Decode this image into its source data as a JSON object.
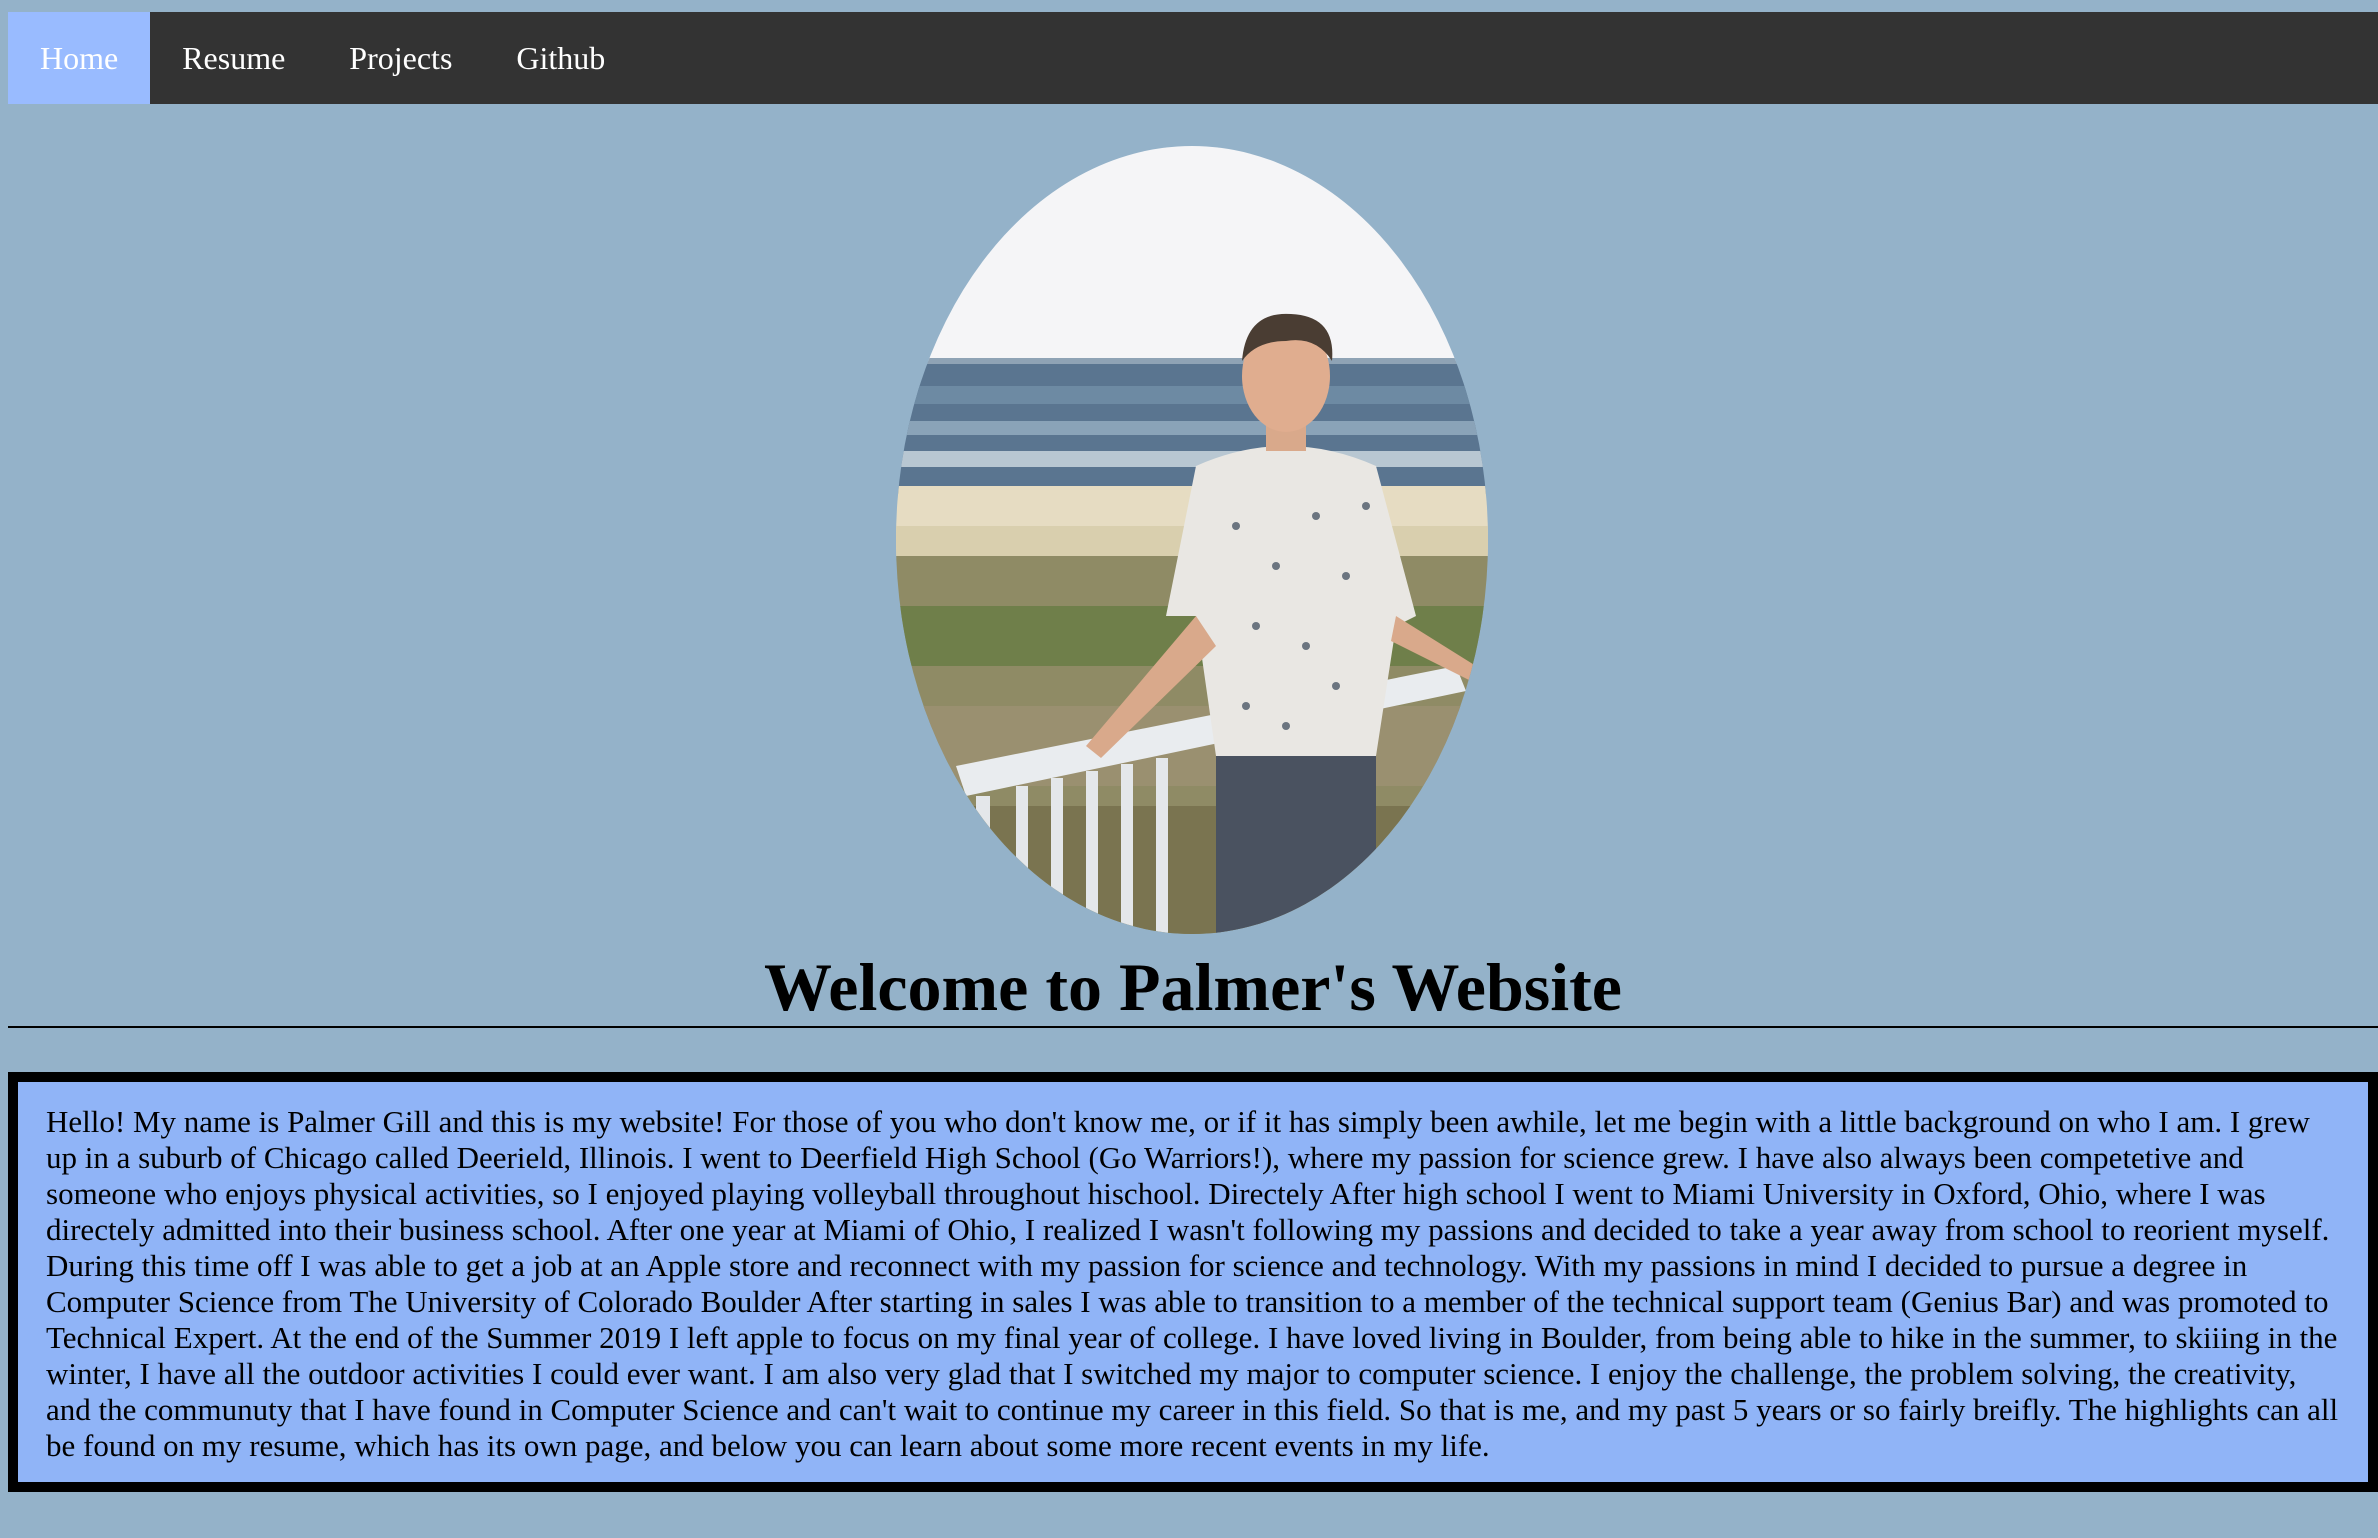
{
  "nav": {
    "items": [
      {
        "label": "Home",
        "active": true
      },
      {
        "label": "Resume",
        "active": false
      },
      {
        "label": "Projects",
        "active": false
      },
      {
        "label": "Github",
        "active": false
      }
    ]
  },
  "hero": {
    "photo_icon": "portrait-photo"
  },
  "page": {
    "title": "Welcome to Palmer's Website"
  },
  "bio": {
    "text": "Hello! My name is Palmer Gill and this is my website! For those of you who don't know me, or if it has simply been awhile, let me begin with a little background on who I am. I grew up in a suburb of Chicago called Deerield, Illinois. I went to Deerfield High School (Go Warriors!), where my passion for science grew. I have also always been competetive and someone who enjoys physical activities, so I enjoyed playing volleyball throughout hischool. Directely After high school I went to Miami University in Oxford, Ohio, where I was directely admitted into their business school. After one year at Miami of Ohio, I realized I wasn't following my passions and decided to take a year away from school to reorient myself. During this time off I was able to get a job at an Apple store and reconnect with my passion for science and technology. With my passions in mind I decided to pursue a degree in Computer Science from The University of Colorado Boulder After starting in sales I was able to transition to a member of the technical support team (Genius Bar) and was promoted to Technical Expert. At the end of the Summer 2019 I left apple to focus on my final year of college. I have loved living in Boulder, from being able to hike in the summer, to skiiing in the winter, I have all the outdoor activities I could ever want. I am also very glad that I switched my major to computer science. I enjoy the challenge, the problem solving, the creativity, and the communuty that I have found in Computer Science and can't wait to continue my career in this field. So that is me, and my past 5 years or so fairly breifly. The highlights can all be found on my resume, which has its own page, and below you can learn about some more recent events in my life."
  },
  "colors": {
    "page_bg": "#94b2c9",
    "nav_bg": "#333333",
    "nav_active": "#99bbff",
    "bio_bg": "#90b4f7"
  }
}
